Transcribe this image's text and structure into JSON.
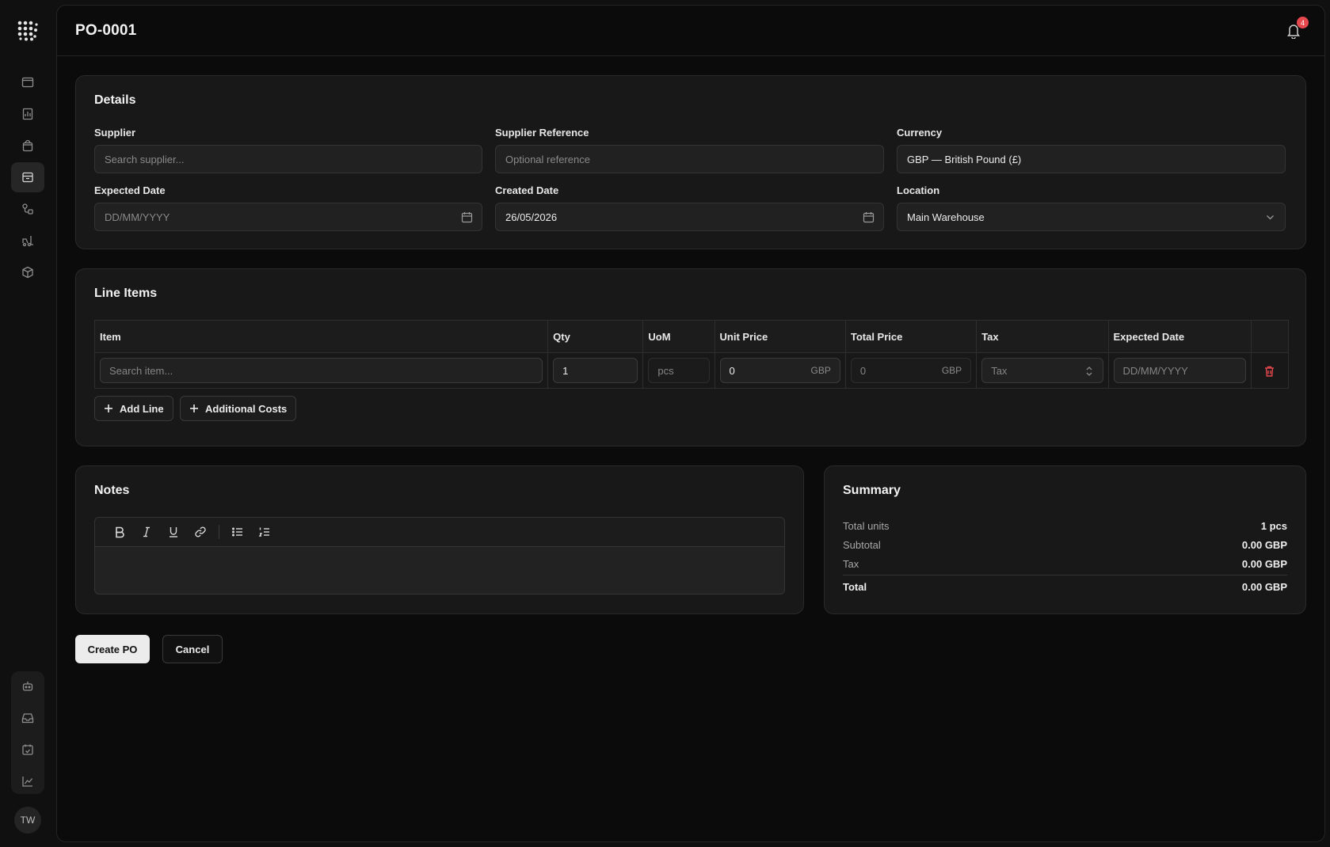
{
  "header": {
    "title": "PO-0001",
    "notification_count": "4"
  },
  "sidebar": {
    "items": [
      {
        "icon": "browser-icon"
      },
      {
        "icon": "report-icon"
      },
      {
        "icon": "bag-icon"
      },
      {
        "icon": "archive-icon",
        "active": true
      },
      {
        "icon": "flow-icon"
      },
      {
        "icon": "forklift-icon"
      },
      {
        "icon": "box-icon"
      }
    ],
    "bottom_items": [
      {
        "icon": "bot-icon"
      },
      {
        "icon": "inbox-icon"
      },
      {
        "icon": "calendar-check-icon"
      },
      {
        "icon": "chart-icon"
      }
    ],
    "avatar": "TW"
  },
  "details": {
    "title": "Details",
    "supplier": {
      "label": "Supplier",
      "placeholder": "Search supplier..."
    },
    "supplier_reference": {
      "label": "Supplier Reference",
      "placeholder": "Optional reference"
    },
    "currency": {
      "label": "Currency",
      "value": "GBP — British Pound (£)"
    },
    "expected_date": {
      "label": "Expected Date",
      "placeholder": "DD/MM/YYYY"
    },
    "created_date": {
      "label": "Created Date",
      "value": "26/05/2026"
    },
    "location": {
      "label": "Location",
      "value": "Main Warehouse"
    }
  },
  "line_items": {
    "title": "Line Items",
    "columns": [
      "Item",
      "Qty",
      "UoM",
      "Unit Price",
      "Total Price",
      "Tax",
      "Expected Date"
    ],
    "rows": [
      {
        "item_placeholder": "Search item...",
        "qty": "1",
        "uom": "pcs",
        "unit_price": "0",
        "unit_price_currency": "GBP",
        "total_price": "0",
        "total_price_currency": "GBP",
        "tax": "Tax",
        "expected_date": "DD/MM/YYYY"
      }
    ],
    "add_line_label": "Add Line",
    "additional_costs_label": "Additional Costs"
  },
  "notes": {
    "title": "Notes"
  },
  "summary": {
    "title": "Summary",
    "total_units_label": "Total units",
    "total_units_value": "1 pcs",
    "subtotal_label": "Subtotal",
    "subtotal_value": "0.00 GBP",
    "tax_label": "Tax",
    "tax_value": "0.00 GBP",
    "total_label": "Total",
    "total_value": "0.00 GBP"
  },
  "actions": {
    "create_label": "Create PO",
    "cancel_label": "Cancel"
  },
  "colors": {
    "danger": "#e5484d",
    "background": "#0b0b0b",
    "card": "#181818"
  }
}
